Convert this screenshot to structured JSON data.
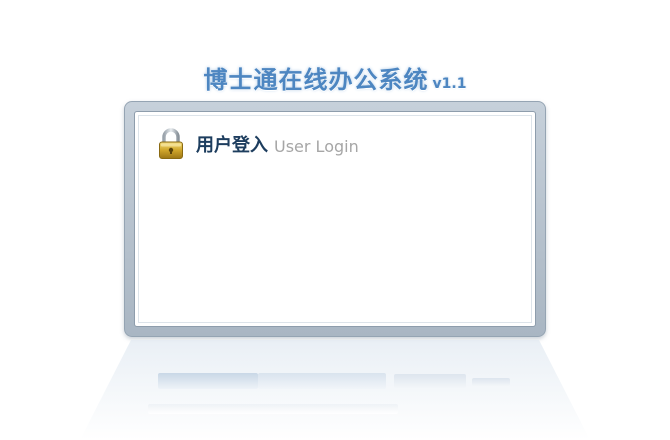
{
  "app": {
    "title": "博士通在线办公系统",
    "version": "v1.1"
  },
  "login_panel": {
    "header_zh": "用户登入",
    "header_en": "User Login"
  },
  "colors": {
    "title_blue": "#4d86c1",
    "frame_gray": "#b7c3cf",
    "header_dark": "#1d3d5e",
    "lock_gold": "#c9a227"
  },
  "icons": {
    "lock": "padlock-icon"
  }
}
